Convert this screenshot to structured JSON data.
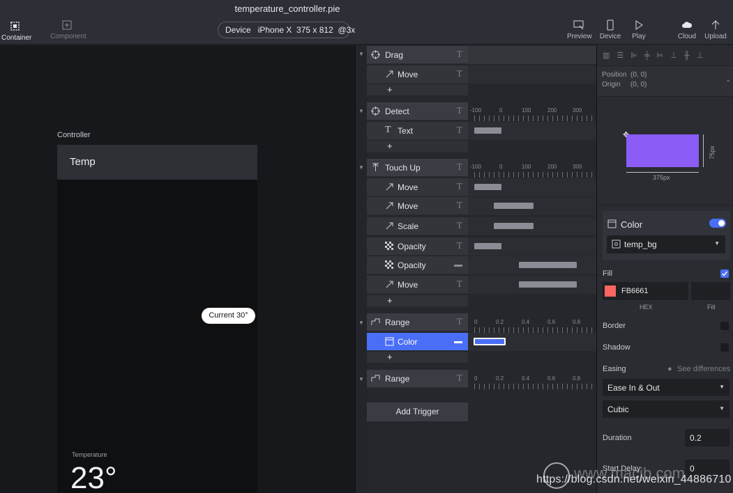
{
  "window": {
    "title": "temperature_controller.pie"
  },
  "toolbar": {
    "container_label": "Container",
    "component_label": "Component",
    "device_label": "Device",
    "device_value": "iPhone X  375 x 812  @3x",
    "preview_label": "Preview",
    "device_btn_label": "Device",
    "play_label": "Play",
    "cloud_label": "Cloud",
    "upload_label": "Upload"
  },
  "canvas": {
    "controller_label": "Controller",
    "temp_title": "Temp",
    "tooltip": "Current 30°",
    "temperature_label": "Temperature",
    "temperature_value": "23°"
  },
  "layers": {
    "t_glyph": "T",
    "add_glyph": "+",
    "add_trigger": "Add Trigger",
    "items": [
      {
        "label": "Drag",
        "type": "group"
      },
      {
        "label": "Move",
        "type": "child"
      },
      {
        "label": "Detect",
        "type": "group"
      },
      {
        "label": "Text",
        "type": "child"
      },
      {
        "label": "Touch Up",
        "type": "group"
      },
      {
        "label": "Move",
        "type": "child"
      },
      {
        "label": "Move",
        "type": "child"
      },
      {
        "label": "Scale",
        "type": "child"
      },
      {
        "label": "Opacity",
        "type": "child"
      },
      {
        "label": "Opacity",
        "type": "child"
      },
      {
        "label": "Move",
        "type": "child"
      },
      {
        "label": "Range",
        "type": "group"
      },
      {
        "label": "Color",
        "type": "child",
        "selected": true
      },
      {
        "label": "Range",
        "type": "group"
      }
    ],
    "ruler_ms": [
      "-100",
      "0",
      "100",
      "200",
      "300"
    ],
    "ruler_range": [
      "0",
      "0.2",
      "0.4",
      "0.6",
      "0.8"
    ]
  },
  "inspector": {
    "position_label": "Position",
    "position_value": "(0, 0)",
    "origin_label": "Origin",
    "origin_value": "(0, 0)",
    "width_label": "375px",
    "height_label": "75px",
    "color_section_title": "Color",
    "color_toggle_on": true,
    "color_source": "temp_bg",
    "fill_label": "Fill",
    "fill_checked": true,
    "hex_value": "FB6661",
    "swatch_color": "#FB6661",
    "hex_caption": "HEX",
    "fill_caption": "Fill",
    "border_label": "Border",
    "shadow_label": "Shadow",
    "easing_label": "Easing",
    "see_differences": "See differences",
    "easing_value": "Ease In & Out",
    "curve_value": "Cubic",
    "duration_label": "Duration",
    "duration_value": "0.2",
    "start_delay_label": "Start Delay",
    "start_delay_value": "0"
  },
  "watermark": {
    "url": "https://blog.csdn.net/weixin_44886710",
    "site": "www.macjb.com"
  },
  "colors": {
    "accent": "#4a6ef5",
    "preview_shape": "#8b5cf6",
    "fill": "#FB6661"
  }
}
